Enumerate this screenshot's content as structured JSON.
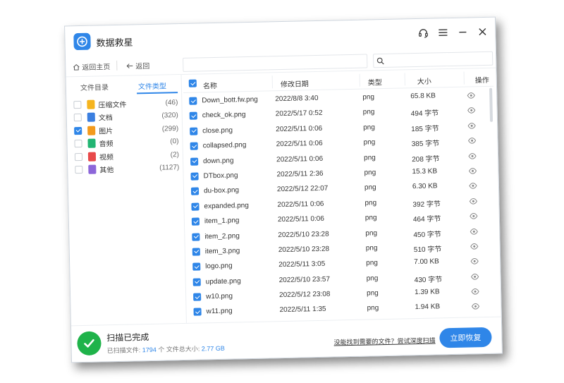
{
  "app": {
    "title": "数据救星"
  },
  "nav": {
    "home_label": "返回主页",
    "back_label": "返回"
  },
  "sidebar": {
    "tabs": [
      {
        "label": "文件目录",
        "active": false
      },
      {
        "label": "文件类型",
        "active": true
      }
    ],
    "types": [
      {
        "label": "压缩文件",
        "count": "(46)",
        "checked": false,
        "icon": "zip-icon",
        "color": "#f5b41e"
      },
      {
        "label": "文档",
        "count": "(320)",
        "checked": false,
        "icon": "document-icon",
        "color": "#3b7fe0"
      },
      {
        "label": "图片",
        "count": "(299)",
        "checked": true,
        "icon": "image-icon",
        "color": "#f39a1c"
      },
      {
        "label": "音频",
        "count": "(0)",
        "checked": false,
        "icon": "audio-icon",
        "color": "#22b573"
      },
      {
        "label": "视频",
        "count": "(2)",
        "checked": false,
        "icon": "video-icon",
        "color": "#e8494a"
      },
      {
        "label": "其他",
        "count": "(1127)",
        "checked": false,
        "icon": "other-icon",
        "color": "#8c66d9"
      }
    ]
  },
  "table": {
    "headers": {
      "name": "名称",
      "date": "修改日期",
      "type": "类型",
      "size": "大小",
      "action": "操作"
    },
    "rows": [
      {
        "name": "Down_bott.fw.png",
        "date": "2022/8/8 3:40",
        "type": "png",
        "size": "65.8 KB"
      },
      {
        "name": "check_ok.png",
        "date": "2022/5/17 0:52",
        "type": "png",
        "size": "494 字节"
      },
      {
        "name": "close.png",
        "date": "2022/5/11 0:06",
        "type": "png",
        "size": "185 字节"
      },
      {
        "name": "collapsed.png",
        "date": "2022/5/11 0:06",
        "type": "png",
        "size": "385 字节"
      },
      {
        "name": "down.png",
        "date": "2022/5/11 0:06",
        "type": "png",
        "size": "208 字节"
      },
      {
        "name": "DTbox.png",
        "date": "2022/5/11 2:36",
        "type": "png",
        "size": "15.3 KB"
      },
      {
        "name": "du-box.png",
        "date": "2022/5/12 22:07",
        "type": "png",
        "size": "6.30 KB"
      },
      {
        "name": "expanded.png",
        "date": "2022/5/11 0:06",
        "type": "png",
        "size": "392 字节"
      },
      {
        "name": "item_1.png",
        "date": "2022/5/11 0:06",
        "type": "png",
        "size": "464 字节"
      },
      {
        "name": "item_2.png",
        "date": "2022/5/10 23:28",
        "type": "png",
        "size": "450 字节"
      },
      {
        "name": "item_3.png",
        "date": "2022/5/10 23:28",
        "type": "png",
        "size": "510 字节"
      },
      {
        "name": "logo.png",
        "date": "2022/5/11 3:05",
        "type": "png",
        "size": "7.00 KB"
      },
      {
        "name": "update.png",
        "date": "2022/5/10 23:57",
        "type": "png",
        "size": "430 字节"
      },
      {
        "name": "w10.png",
        "date": "2022/5/12 23:08",
        "type": "png",
        "size": "1.39 KB"
      },
      {
        "name": "w11.png",
        "date": "2022/5/11 1:35",
        "type": "png",
        "size": "1.94 KB"
      }
    ]
  },
  "footer": {
    "status_title": "扫描已完成",
    "scanned_label": "已扫描文件:",
    "scanned_count": "1794",
    "scanned_unit": "个",
    "total_size_label": "文件总大小:",
    "total_size": "2.77 GB",
    "help_link": "没能找到需要的文件？尝试深度扫描",
    "recover_button": "立即恢复"
  },
  "colors": {
    "accent": "#2f86e8",
    "success": "#1fb34a"
  }
}
